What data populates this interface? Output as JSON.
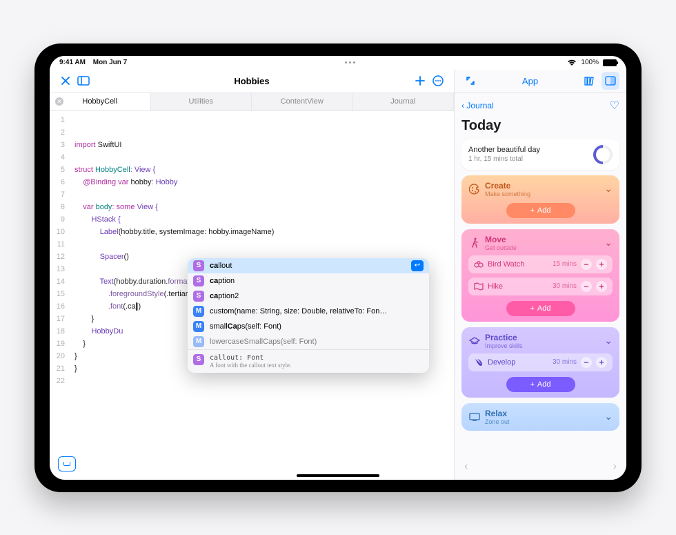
{
  "status": {
    "time": "9:41 AM",
    "date": "Mon Jun 7",
    "battery": "100%"
  },
  "editor": {
    "title": "Hobbies",
    "tabs": [
      "HobbyCell",
      "Utilities",
      "ContentView",
      "Journal"
    ],
    "code": {
      "l1": "",
      "l2_import": "import",
      "l2_mod": "SwiftUI",
      "l4_struct": "struct",
      "l4_name": "HobbyCell",
      "l4_view": ": View {",
      "l5_bind": "@Binding",
      "l5_var": "var",
      "l5_hobby": "hobby",
      "l5_type": ": Hobby",
      "l7_var": "var",
      "l7_body": "body",
      "l7_some": ": some",
      "l7_view": "View {",
      "l8_hstack": "HStack {",
      "l9_label": "Label",
      "l9_args": "(hobby.title, systemImage: hobby.imageName)",
      "l11_spacer": "Spacer",
      "l11_p": "()",
      "l13_text": "Text",
      "l13_args": "(hobby.duration.",
      "l13_fmt": "formatted",
      "l13_p": "())",
      "l14_fg": ".foregroundStyle",
      "l14_arg": "(.tertiary)",
      "l15_font": ".font",
      "l15_arg": "(.ca",
      "l15_caret": "|",
      "l16": "}",
      "l17_hd": "HobbyDu",
      "l18": "}",
      "l19": "}",
      "l20": "}"
    }
  },
  "autocomplete": {
    "items": [
      {
        "badge": "S",
        "pre": "ca",
        "rest": "llout",
        "selected": true
      },
      {
        "badge": "S",
        "pre": "ca",
        "rest": "ption"
      },
      {
        "badge": "S",
        "pre": "ca",
        "rest": "ption2"
      },
      {
        "badge": "M",
        "text": "custom(name: String, size: Double, relativeTo: Fon…"
      },
      {
        "badge": "M",
        "text": "smallCaps(self: Font)",
        "boldStart": 5,
        "boldLen": 2
      },
      {
        "badge": "M",
        "text": "lowercaseSmallCaps(self: Font)"
      }
    ],
    "doc": {
      "sig": "callout: Font",
      "desc": "A font with the callout text style."
    }
  },
  "preview": {
    "title": "App",
    "back": "Journal",
    "heading": "Today",
    "summary": {
      "line1": "Another beautiful day",
      "line2": "1 hr, 15 mins total"
    },
    "categories": [
      {
        "key": "create",
        "name": "Create",
        "sub": "Make something",
        "add": "Add"
      },
      {
        "key": "move",
        "name": "Move",
        "sub": "Get outside",
        "add": "Add",
        "items": [
          {
            "icon": "bird",
            "label": "Bird Watch",
            "dur": "15 mins"
          },
          {
            "icon": "map",
            "label": "Hike",
            "dur": "30 mins"
          }
        ]
      },
      {
        "key": "practice",
        "name": "Practice",
        "sub": "Improve skills",
        "add": "Add",
        "items": [
          {
            "icon": "swift",
            "label": "Develop",
            "dur": "30 mins"
          }
        ]
      },
      {
        "key": "relax",
        "name": "Relax",
        "sub": "Zone out"
      }
    ]
  }
}
